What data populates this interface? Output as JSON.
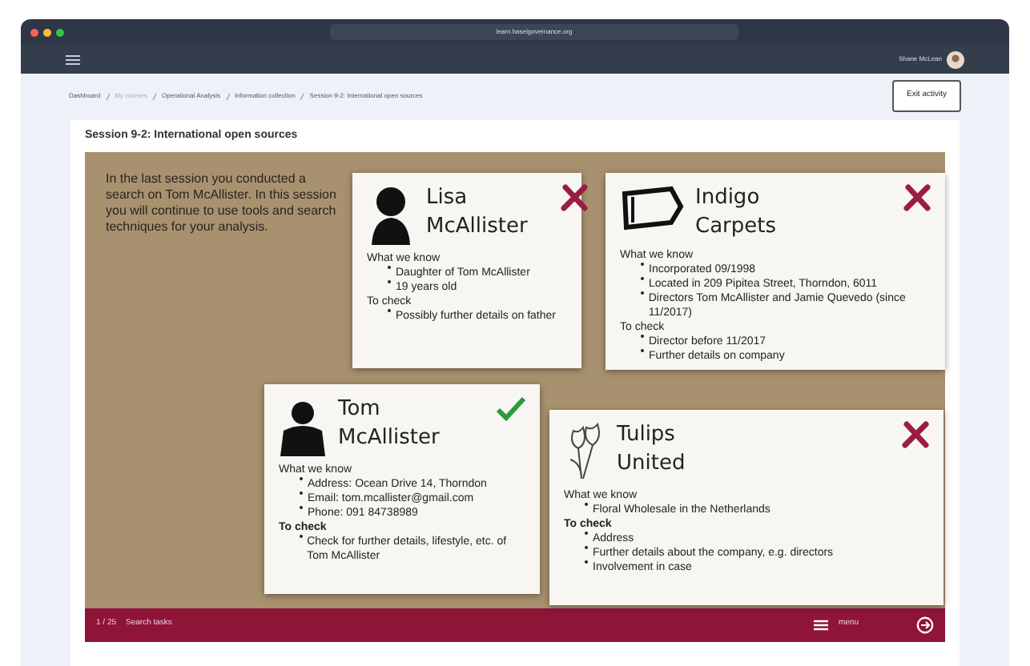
{
  "browser": {
    "url": "learn.baselgovernance.org"
  },
  "navbar": {
    "user": "Shane McLean"
  },
  "breadcrumb": [
    {
      "label": "Dashboard",
      "disabled": false
    },
    {
      "label": "My courses",
      "disabled": true
    },
    {
      "label": "Operational Analysis",
      "disabled": false
    },
    {
      "label": "Information collection",
      "disabled": false
    },
    {
      "label": "Session 9-2: International open sources",
      "disabled": false
    }
  ],
  "exit_button": "Exit activity",
  "activity": {
    "title": "Session 9-2: International open sources",
    "intro": "In the last session you conducted a search on Tom McAllister. In this session you will continue to use tools and search techniques for your analysis.",
    "cards": [
      {
        "kind": "woman",
        "name": "Lisa McAllister",
        "confirmed": false,
        "know_heading": "What we know",
        "known": [
          "Daughter of Tom McAllister",
          "19 years old"
        ],
        "check_heading": "To check",
        "check_bold": false,
        "to_check": [
          "Possibly further details on father"
        ]
      },
      {
        "kind": "rug",
        "name": "Indigo Carpets",
        "confirmed": false,
        "know_heading": "What we know",
        "known": [
          "Incorporated 09/1998",
          "Located in 209 Pipitea Street, Thorndon, 6011",
          "Directors Tom McAllister and Jamie Quevedo (since 11/2017)"
        ],
        "check_heading": "To check",
        "check_bold": false,
        "to_check": [
          "Director before 11/2017",
          "Further details on company"
        ]
      },
      {
        "kind": "man",
        "name": "Tom McAllister",
        "confirmed": true,
        "know_heading": "What we know",
        "known": [
          "Address: Ocean Drive 14, Thorndon",
          "Email: tom.mcallister@gmail.com",
          "Phone: 091 84738989"
        ],
        "check_heading": "To check",
        "check_bold": true,
        "to_check": [
          "Check for further details, lifestyle, etc. of Tom McAllister"
        ]
      },
      {
        "kind": "tulip",
        "name": "Tulips United",
        "confirmed": false,
        "know_heading": "What we know",
        "known": [
          "Floral Wholesale in the Netherlands"
        ],
        "check_heading": "To check",
        "check_bold": true,
        "to_check": [
          "Address",
          "Further details about the company, e.g. directors",
          "Involvement in case"
        ]
      }
    ],
    "footer": {
      "page": "1 / 25",
      "search": "Search tasks",
      "menu": "menu"
    }
  }
}
